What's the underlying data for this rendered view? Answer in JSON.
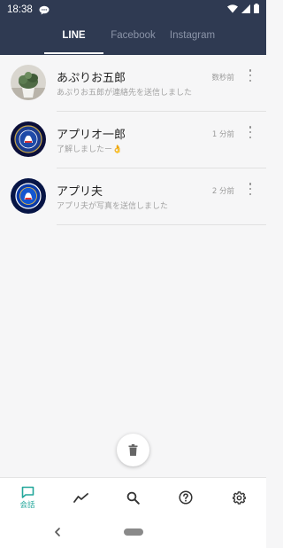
{
  "status_bar": {
    "time": "18:38",
    "icons": [
      "line-chat-icon",
      "wifi-icon",
      "cell-signal-icon",
      "battery-icon"
    ]
  },
  "tabs": [
    {
      "label": "LINE",
      "active": true
    },
    {
      "label": "Facebook",
      "active": false
    },
    {
      "label": "Instagram",
      "active": false
    }
  ],
  "conversations": [
    {
      "name": "あぷりお五郎",
      "time": "数秒前",
      "preview": "あぷりお五郎が連絡先を送信しました",
      "avatar": "plant-photo"
    },
    {
      "name": "アプリオ一郎",
      "time": "1 分前",
      "preview": "了解しましたー👌",
      "avatar": "chelsea-crest-dark"
    },
    {
      "name": "アプリ夫",
      "time": "2 分前",
      "preview": "アプリ夫が写真を送信しました",
      "avatar": "chelsea-crest"
    }
  ],
  "fab": {
    "icon": "trash-icon"
  },
  "bottom_nav": {
    "items": [
      {
        "icon": "chat-icon",
        "label": "会話",
        "active": true
      },
      {
        "icon": "trend-icon"
      },
      {
        "icon": "search-icon"
      },
      {
        "icon": "help-icon"
      },
      {
        "icon": "settings-icon"
      }
    ]
  },
  "colors": {
    "header": "#2f3a52",
    "accent": "#23a79b",
    "background": "#f6f6f7"
  }
}
